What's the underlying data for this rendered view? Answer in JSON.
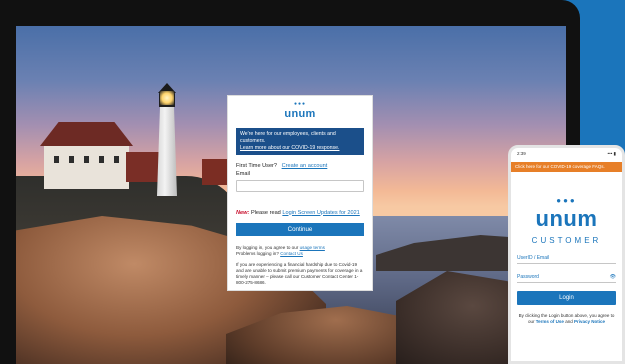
{
  "login": {
    "logo_text": "unum",
    "banner_line1": "We're here for our employees, clients and customers.",
    "banner_link": "Learn more about our COVID-19 response.",
    "first_time_label": "First Time User?",
    "create_account_link": "Create an account",
    "email_label": "Email",
    "email_value": "",
    "notice_new": "New:",
    "notice_text": "Please read",
    "notice_link": "Login Screen Updates for 2021",
    "continue_label": "Continue",
    "fine_prefix": "By logging in, you agree to our",
    "usage_terms_link": "usage terms",
    "fine_problems": "Problems logging in?",
    "contact_link": "Contact Us",
    "hardship_text": "If you are experiencing a financial hardship due to Covid-19 and are unable to submit premium payments for coverage in a timely manner – please call our Customer Contact Center 1-800-275-8686."
  },
  "phone": {
    "status_time": "2:39",
    "status_right": "••• ▮",
    "top_banner": "Click here for our COVID-19 coverage FAQs.",
    "logo_text": "unum",
    "customer_label": "CUSTOMER",
    "userid_placeholder": "UserID / Email",
    "password_placeholder": "Password",
    "login_label": "Login",
    "fine_prefix": "By clicking the Login button above, you agree to our",
    "terms_link": "Terms of Use",
    "and_text": "and",
    "privacy_link": "Privacy Notice"
  },
  "colors": {
    "brand_blue": "#1b75bb",
    "banner_navy": "#1b4f8a",
    "phone_orange": "#e77f28",
    "alert_red": "#c8102e"
  }
}
